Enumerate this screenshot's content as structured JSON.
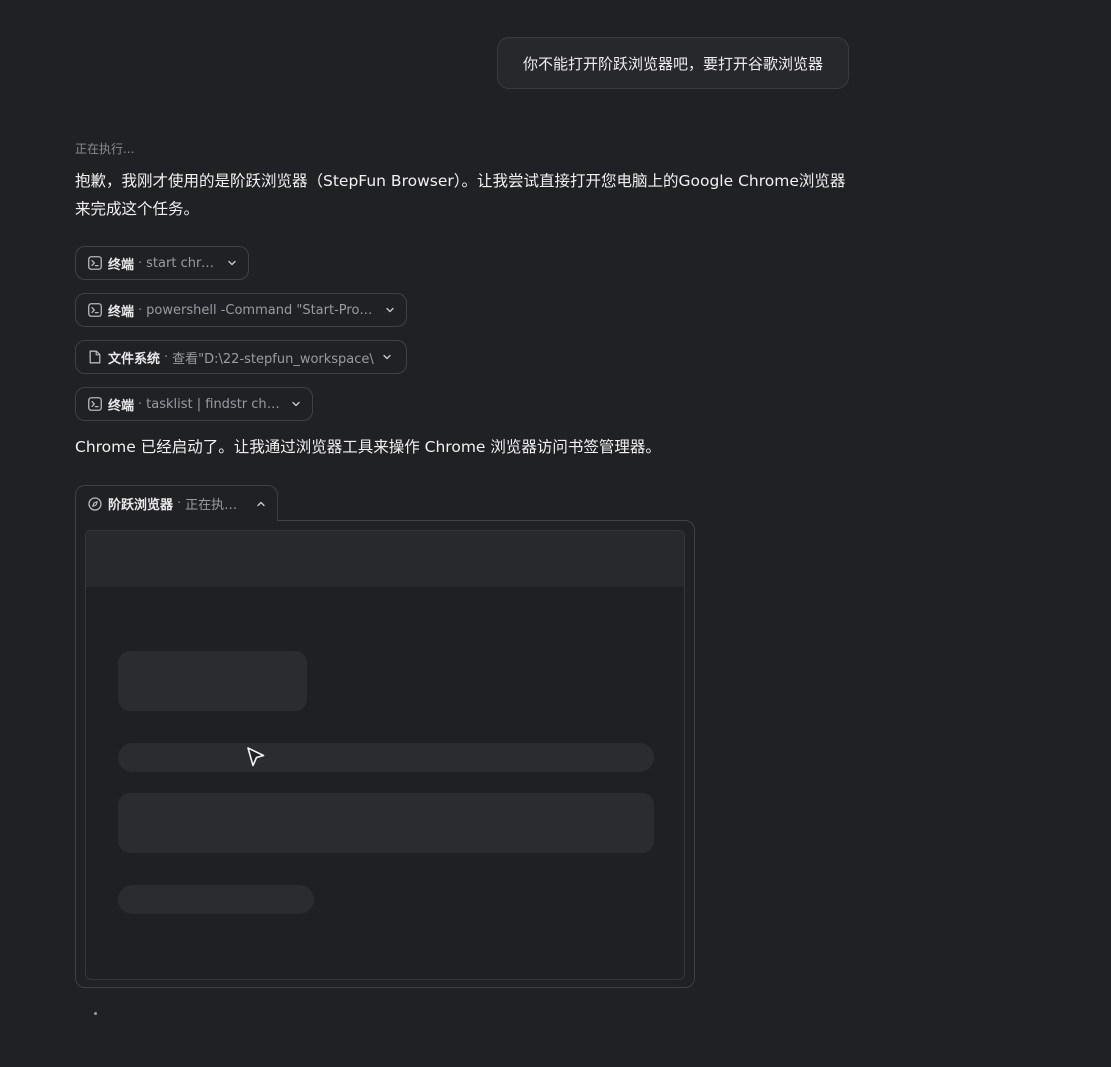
{
  "user_message": "你不能打开阶跃浏览器吧，要打开谷歌浏览器",
  "assistant": {
    "status": "正在执行...",
    "reply": "抱歉，我刚才使用的是阶跃浏览器（StepFun Browser）。让我尝试直接打开您电脑上的Google Chrome浏览器来完成这个任务。",
    "tool_calls": [
      {
        "name": "终端",
        "command": "start chrome",
        "icon": "terminal-icon"
      },
      {
        "name": "终端",
        "command": "powershell -Command \"Start-Process",
        "icon": "terminal-icon"
      },
      {
        "name": "文件系统",
        "command": "查看\"D:\\22-stepfun_workspace\\",
        "icon": "file-icon"
      },
      {
        "name": "终端",
        "command": "tasklist | findstr chrome",
        "icon": "terminal-icon"
      }
    ],
    "followup": "Chrome 已经启动了。让我通过浏览器工具来操作 Chrome 浏览器访问书签管理器。",
    "browser_tool": {
      "name": "阶跃浏览器",
      "status": "正在执行中",
      "icon": "compass-icon"
    }
  },
  "separator": "·",
  "colors": {
    "background": "#202124",
    "border": "#404146",
    "skeleton": "#2b2c30",
    "text_primary": "#f1f1f2",
    "text_muted": "#9a9ba0"
  }
}
